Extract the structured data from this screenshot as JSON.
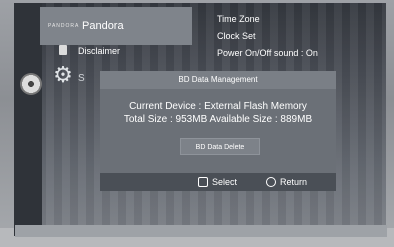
{
  "menu": {
    "pandora_logo": "PANDORA",
    "pandora_label": "Pandora",
    "disclaimer_label": "Disclaimer",
    "side_letter": "S",
    "right_items": [
      "Time Zone",
      "Clock Set",
      "Power On/Off sound :  On"
    ],
    "right_marker": "•"
  },
  "dialog": {
    "title": "BD Data Management",
    "current_device": "Current Device : External Flash Memory",
    "sizes": "Total Size : 953MB     Available Size : 889MB",
    "delete_button": "BD Data Delete",
    "hint_select": "Select",
    "hint_return": "Return"
  },
  "icons": [
    "disc-icon",
    "gear-icon",
    "disclaimer-icon",
    "select-icon",
    "return-icon"
  ]
}
